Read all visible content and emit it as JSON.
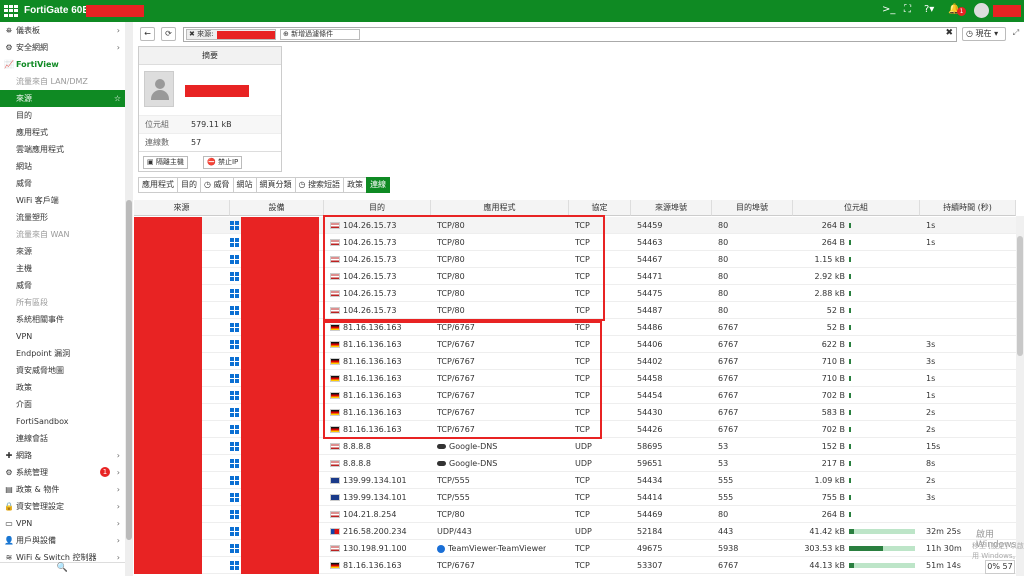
{
  "app": {
    "title": "FortiGate 60E",
    "badge_count": "1"
  },
  "sidebar": {
    "items": [
      {
        "label": "儀表板",
        "type": "head",
        "icon": "dashboard-icon",
        "arrow": true
      },
      {
        "label": "安全網網",
        "type": "head",
        "icon": "security-fabric-icon",
        "arrow": true
      },
      {
        "label": "FortiView",
        "type": "green",
        "icon": "fortiview-icon",
        "arrow": false
      },
      {
        "label": "流量來自 LAN/DMZ",
        "type": "section"
      },
      {
        "label": "來源",
        "type": "active"
      },
      {
        "label": "目的"
      },
      {
        "label": "應用程式"
      },
      {
        "label": "雲端應用程式"
      },
      {
        "label": "網站"
      },
      {
        "label": "威脅"
      },
      {
        "label": "WiFi 客戶端"
      },
      {
        "label": "流量塑形"
      },
      {
        "label": "流量來自 WAN",
        "type": "section"
      },
      {
        "label": "來源"
      },
      {
        "label": "主機"
      },
      {
        "label": "威脅"
      },
      {
        "label": "所有區段",
        "type": "section"
      },
      {
        "label": "系統相關事件"
      },
      {
        "label": "VPN"
      },
      {
        "label": "Endpoint 漏洞"
      },
      {
        "label": "資安威脅地圖"
      },
      {
        "label": "政策"
      },
      {
        "label": "介面"
      },
      {
        "label": "FortiSandbox"
      },
      {
        "label": "連線會話"
      },
      {
        "label": "網路",
        "type": "head",
        "icon": "network-icon",
        "arrow": true
      },
      {
        "label": "系統管理",
        "type": "head",
        "icon": "gear-icon",
        "arrow": true,
        "badge": "1"
      },
      {
        "label": "政策 & 物件",
        "type": "head",
        "icon": "policy-icon",
        "arrow": true
      },
      {
        "label": "資安管理設定",
        "type": "head",
        "icon": "lock-icon",
        "arrow": true
      },
      {
        "label": "VPN",
        "type": "head",
        "icon": "vpn-icon",
        "arrow": true
      },
      {
        "label": "用戶與設備",
        "type": "head",
        "icon": "user-icon",
        "arrow": true
      },
      {
        "label": "WiFi & Switch 控制器",
        "type": "head",
        "icon": "wifi-icon",
        "arrow": true
      }
    ]
  },
  "toolbar": {
    "filter_prefix": "來源:",
    "add_filter": "新增過濾條件",
    "time_label": "現在"
  },
  "summary": {
    "title": "摘要",
    "bytes_label": "位元組",
    "bytes_value": "579.11 kB",
    "sessions_label": "連線數",
    "sessions_value": "57",
    "quarantine": "隔離主機",
    "ban_ip": "禁止IP"
  },
  "tabs": [
    "應用程式",
    "目的",
    "威脅",
    "網站",
    "網頁分類",
    "搜索短語",
    "政策",
    "連線"
  ],
  "columns": [
    "來源",
    "設備",
    "目的",
    "應用程式",
    "協定",
    "來源埠號",
    "目的埠號",
    "位元組",
    "持續時間 (秒)"
  ],
  "rows": [
    {
      "flag": "us",
      "dest": "104.26.15.73",
      "app": "TCP/80",
      "proto": "TCP",
      "sport": "54459",
      "dport": "80",
      "bytes": "264 B",
      "dur": "1s"
    },
    {
      "flag": "us",
      "dest": "104.26.15.73",
      "app": "TCP/80",
      "proto": "TCP",
      "sport": "54463",
      "dport": "80",
      "bytes": "264 B",
      "dur": "1s"
    },
    {
      "flag": "us",
      "dest": "104.26.15.73",
      "app": "TCP/80",
      "proto": "TCP",
      "sport": "54467",
      "dport": "80",
      "bytes": "1.15 kB",
      "dur": ""
    },
    {
      "flag": "us",
      "dest": "104.26.15.73",
      "app": "TCP/80",
      "proto": "TCP",
      "sport": "54471",
      "dport": "80",
      "bytes": "2.92 kB",
      "dur": ""
    },
    {
      "flag": "us",
      "dest": "104.26.15.73",
      "app": "TCP/80",
      "proto": "TCP",
      "sport": "54475",
      "dport": "80",
      "bytes": "2.88 kB",
      "dur": ""
    },
    {
      "flag": "us",
      "dest": "104.26.15.73",
      "app": "TCP/80",
      "proto": "TCP",
      "sport": "54487",
      "dport": "80",
      "bytes": "52 B",
      "dur": ""
    },
    {
      "flag": "de",
      "dest": "81.16.136.163",
      "app": "TCP/6767",
      "proto": "TCP",
      "sport": "54486",
      "dport": "6767",
      "bytes": "52 B",
      "dur": ""
    },
    {
      "flag": "de",
      "dest": "81.16.136.163",
      "app": "TCP/6767",
      "proto": "TCP",
      "sport": "54406",
      "dport": "6767",
      "bytes": "622 B",
      "dur": "3s"
    },
    {
      "flag": "de",
      "dest": "81.16.136.163",
      "app": "TCP/6767",
      "proto": "TCP",
      "sport": "54402",
      "dport": "6767",
      "bytes": "710 B",
      "dur": "3s"
    },
    {
      "flag": "de",
      "dest": "81.16.136.163",
      "app": "TCP/6767",
      "proto": "TCP",
      "sport": "54458",
      "dport": "6767",
      "bytes": "710 B",
      "dur": "1s"
    },
    {
      "flag": "de",
      "dest": "81.16.136.163",
      "app": "TCP/6767",
      "proto": "TCP",
      "sport": "54454",
      "dport": "6767",
      "bytes": "702 B",
      "dur": "1s"
    },
    {
      "flag": "de",
      "dest": "81.16.136.163",
      "app": "TCP/6767",
      "proto": "TCP",
      "sport": "54430",
      "dport": "6767",
      "bytes": "583 B",
      "dur": "2s"
    },
    {
      "flag": "de",
      "dest": "81.16.136.163",
      "app": "TCP/6767",
      "proto": "TCP",
      "sport": "54426",
      "dport": "6767",
      "bytes": "702 B",
      "dur": "2s"
    },
    {
      "flag": "us",
      "dest": "8.8.8.8",
      "app": "Google-DNS",
      "appicon": "cloud",
      "proto": "UDP",
      "sport": "58695",
      "dport": "53",
      "bytes": "152 B",
      "dur": "15s"
    },
    {
      "flag": "us",
      "dest": "8.8.8.8",
      "app": "Google-DNS",
      "appicon": "cloud",
      "proto": "UDP",
      "sport": "59651",
      "dport": "53",
      "bytes": "217 B",
      "dur": "8s"
    },
    {
      "flag": "au",
      "dest": "139.99.134.101",
      "app": "TCP/555",
      "proto": "TCP",
      "sport": "54434",
      "dport": "555",
      "bytes": "1.09 kB",
      "dur": "2s"
    },
    {
      "flag": "au",
      "dest": "139.99.134.101",
      "app": "TCP/555",
      "proto": "TCP",
      "sport": "54414",
      "dport": "555",
      "bytes": "755 B",
      "dur": "3s"
    },
    {
      "flag": "us",
      "dest": "104.21.8.254",
      "app": "TCP/80",
      "proto": "TCP",
      "sport": "54469",
      "dport": "80",
      "bytes": "264 B",
      "dur": ""
    },
    {
      "flag": "tw",
      "dest": "216.58.200.234",
      "app": "UDP/443",
      "proto": "UDP",
      "sport": "52184",
      "dport": "443",
      "bytes": "41.42 kB",
      "dur": "32m 25s",
      "bar": 0.08
    },
    {
      "flag": "us",
      "dest": "130.198.91.100",
      "app": "TeamViewer-TeamViewer",
      "appicon": "tv",
      "proto": "TCP",
      "sport": "49675",
      "dport": "5938",
      "bytes": "303.53 kB",
      "dur": "11h 30m",
      "bar": 0.52
    },
    {
      "flag": "de",
      "dest": "81.16.136.163",
      "app": "TCP/6767",
      "proto": "TCP",
      "sport": "53307",
      "dport": "6767",
      "bytes": "44.13 kB",
      "dur": "51m 14s",
      "bar": 0.08
    }
  ],
  "watermark": {
    "line1": "啟用 Windows",
    "line2": "移至 [設定] 以啟用 Windows。"
  },
  "pager": "0% 57"
}
